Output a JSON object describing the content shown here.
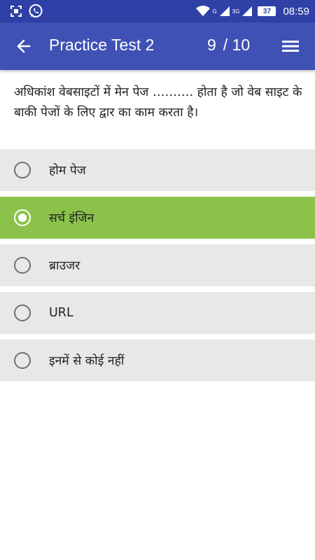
{
  "status_bar": {
    "time": "08:59",
    "battery": "37",
    "sim1_label": "G",
    "sim2_label": "3G"
  },
  "header": {
    "title": "Practice Test 2",
    "current": "9",
    "total": "/ 10"
  },
  "question": {
    "text": "अधिकांश वेबसाइटों में मेन पेज ………. होता है जो वेब साइट के बाकी पेजों के लिए द्वार का काम करता है।"
  },
  "options": [
    {
      "label": "होम पेज",
      "selected": false
    },
    {
      "label": "सर्च इंजिन",
      "selected": true
    },
    {
      "label": "ब्राउजर",
      "selected": false
    },
    {
      "label": "URL",
      "selected": false
    },
    {
      "label": "इनमें से कोई नहीं",
      "selected": false
    }
  ],
  "colors": {
    "status_bar": "#2f41a6",
    "app_bar": "#3f51b5",
    "option_bg": "#e8e8e8",
    "selected_bg": "#8bc34a"
  }
}
